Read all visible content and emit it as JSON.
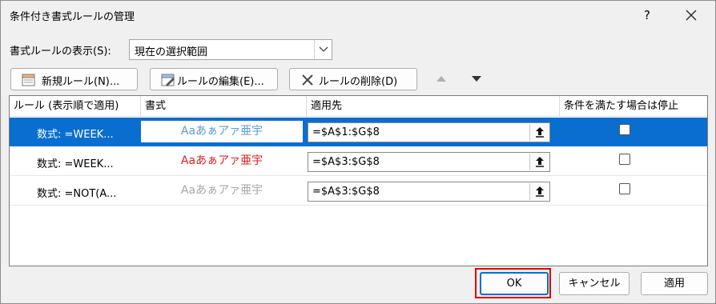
{
  "dialog": {
    "title": "条件付き書式ルールの管理",
    "help": "?",
    "show_rules_for_label": "書式ルールの表示(S):",
    "show_rules_for_value": "現在の選択範囲"
  },
  "toolbar": {
    "new_rule": "新規ルール(N)...",
    "edit_rule": "ルールの編集(E)...",
    "delete_rule": "ルールの削除(D)"
  },
  "table": {
    "headers": [
      "ルール (表示順で適用)",
      "書式",
      "適用先",
      "条件を満たす場合は停止"
    ],
    "rows": [
      {
        "rule": "数式: =WEEK...",
        "format": "Aaあぁアァ亜宇",
        "format_color": "#5b9bd5",
        "applies_to": "=$A$1:$G$8",
        "stop_if_true": false,
        "selected": true
      },
      {
        "rule": "数式: =WEEK...",
        "format": "Aaあぁアァ亜宇",
        "format_color": "#e02020",
        "applies_to": "=$A$3:$G$8",
        "stop_if_true": false,
        "selected": false
      },
      {
        "rule": "数式: =NOT(A...",
        "format": "Aaあぁアァ亜宇",
        "format_color": "#a6a6a6",
        "applies_to": "=$A$3:$G$8",
        "stop_if_true": false,
        "selected": false
      }
    ]
  },
  "footer": {
    "ok": "OK",
    "cancel": "キャンセル",
    "apply": "適用"
  },
  "colors": {
    "selection": "#0a6ed1",
    "highlight_frame": "#e00000"
  },
  "icons": [
    "new-rule-icon",
    "edit-rule-icon",
    "delete-rule-icon",
    "move-up-icon",
    "move-down-icon",
    "collapse-dialog-icon",
    "close-icon",
    "dropdown-arrow-icon"
  ]
}
